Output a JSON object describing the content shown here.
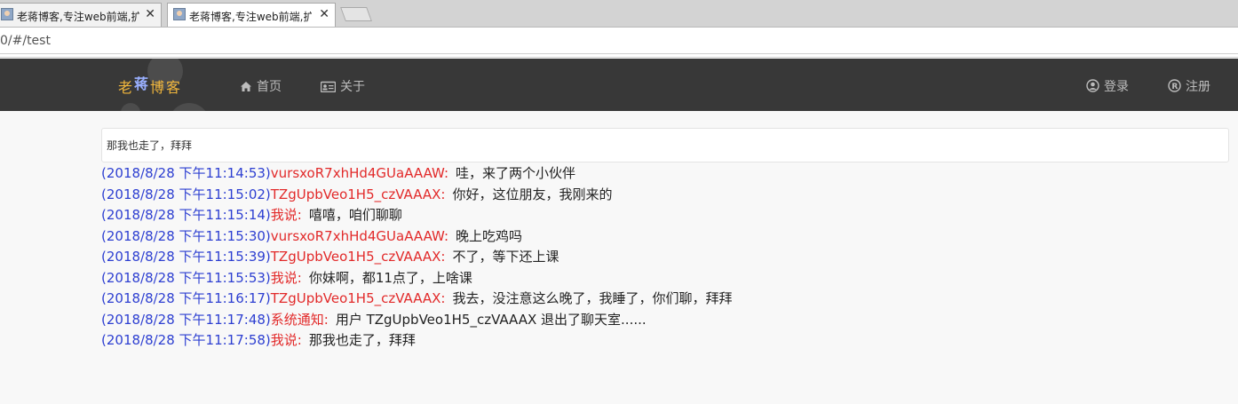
{
  "browser": {
    "tabs": [
      {
        "title": "老蒋博客,专注web前端,扩",
        "close": "✕"
      },
      {
        "title": "老蒋博客,专注web前端,扩",
        "close": "✕"
      }
    ],
    "url": "0/#/test"
  },
  "navbar": {
    "brand": [
      "老",
      "蒋",
      "博客"
    ],
    "links": {
      "home": "首页",
      "about": "关于",
      "login": "登录",
      "register": "注册"
    }
  },
  "chat": {
    "input_value": "那我也走了，拜拜",
    "messages": [
      {
        "time": "(2018/8/28 下午11:14:53)",
        "sender": "vursxoR7xhHd4GUaAAAW:",
        "text": "哇，来了两个小伙伴"
      },
      {
        "time": "(2018/8/28 下午11:15:02)",
        "sender": "TZgUpbVeo1H5_czVAAAX:",
        "text": "你好，这位朋友，我刚来的"
      },
      {
        "time": "(2018/8/28 下午11:15:14)",
        "sender": "我说:",
        "text": "嘻嘻，咱们聊聊"
      },
      {
        "time": "(2018/8/28 下午11:15:30)",
        "sender": "vursxoR7xhHd4GUaAAAW:",
        "text": "晚上吃鸡吗"
      },
      {
        "time": "(2018/8/28 下午11:15:39)",
        "sender": "TZgUpbVeo1H5_czVAAAX:",
        "text": "不了，等下还上课"
      },
      {
        "time": "(2018/8/28 下午11:15:53)",
        "sender": "我说:",
        "text": "你妹啊，都11点了，上啥课"
      },
      {
        "time": "(2018/8/28 下午11:16:17)",
        "sender": "TZgUpbVeo1H5_czVAAAX:",
        "text": "我去，没注意这么晚了，我睡了，你们聊，拜拜"
      },
      {
        "time": "(2018/8/28 下午11:17:48)",
        "sender": "系统通知:",
        "text": "用户 TZgUpbVeo1H5_czVAAAX 退出了聊天室......"
      },
      {
        "time": "(2018/8/28 下午11:17:58)",
        "sender": "我说:",
        "text": "那我也走了，拜拜"
      }
    ]
  },
  "colors": {
    "navbar_bg": "#383838",
    "time": "#2d3fd1",
    "sender": "#e22a2a",
    "brand": "#f0b63c"
  }
}
